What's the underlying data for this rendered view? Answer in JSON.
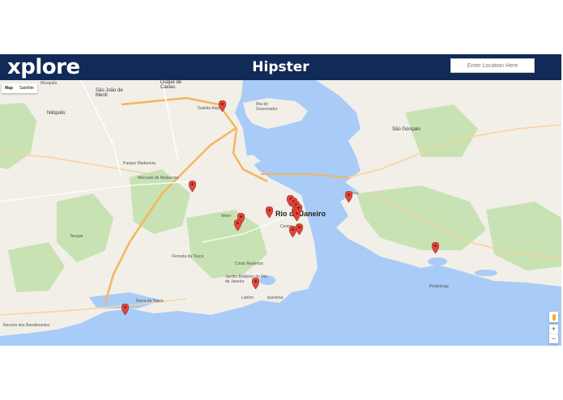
{
  "header": {
    "logo": "xplore",
    "title": "Hipster",
    "search_placeholder": "Enter Location Here",
    "bg_color": "#112a58"
  },
  "map": {
    "map_types": [
      "Map",
      "Satellite"
    ],
    "selected_type": "Map",
    "zoom_in": "+",
    "zoom_out": "−",
    "pegman_icon": "pegman-icon",
    "pin_color": "#e2463a",
    "land_color": "#f1efe8",
    "park_color": "#c8e2b4",
    "water_color": "#a9cbf7",
    "road_color": "#f5b65a",
    "labels": {
      "rio": "Rio de Janeiro",
      "sao_goncalo": "São Gonçalo",
      "sao_joao": "São João de Meriti",
      "duque": "Duque de Caxias",
      "nilopolis": "Nilópolis",
      "niteroi": "Niterói",
      "mesquita": "Mesquita",
      "ilha": "Ilha do Governador",
      "madureira": "Mercado de Madureira",
      "parque": "Parque Madureira",
      "tijuca": "Floresta da Tijuca",
      "cristo": "Cristo Redentor",
      "botanico": "Jardim Botânico do Rio de Janeiro",
      "leblon": "Leblon",
      "ipanema": "Ipanema",
      "barra": "Barra da Tijuca",
      "recreio": "Recreio dos Bandeirantes",
      "galeao": "Galeão Airport",
      "tanque": "Tanque",
      "meier": "Méier",
      "centro": "Centro",
      "piratininga": "Piratininga"
    },
    "pins": [
      {
        "name": "pin-ilha-governador"
      },
      {
        "name": "pin-madureira"
      },
      {
        "name": "pin-meier"
      },
      {
        "name": "pin-engenho-novo"
      },
      {
        "name": "pin-sao-cristovao"
      },
      {
        "name": "pin-centro-1"
      },
      {
        "name": "pin-centro-2"
      },
      {
        "name": "pin-centro-3"
      },
      {
        "name": "pin-centro-4"
      },
      {
        "name": "pin-centro-5"
      },
      {
        "name": "pin-santa-teresa"
      },
      {
        "name": "pin-gloria"
      },
      {
        "name": "pin-flamengo"
      },
      {
        "name": "pin-lagoa"
      },
      {
        "name": "pin-barra"
      },
      {
        "name": "pin-niteroi"
      },
      {
        "name": "pin-piratininga"
      }
    ]
  }
}
